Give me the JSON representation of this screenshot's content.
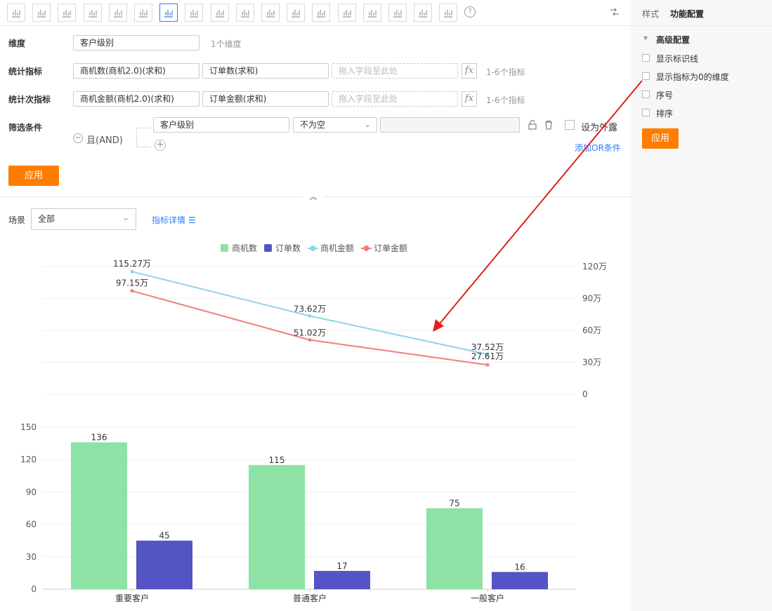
{
  "toolbar": {
    "icons": [
      "bar-chart",
      "line-chart",
      "pie-chart",
      "funnel",
      "funnel-alt",
      "table",
      "combo-chart",
      "text-card",
      "gauge",
      "china-map",
      "world-map",
      "globe-map",
      "bubble-map",
      "column-chart",
      "area-chart",
      "heat-table",
      "cross-table",
      "scatter-chart"
    ],
    "help": "?"
  },
  "config": {
    "dimension_label": "维度",
    "dimension_value": "客户级别",
    "dimension_hint": "1个维度",
    "metric_label": "统计指标",
    "metric_1": "商机数(商机2.0)(求和)",
    "metric_2": "订单数(求和)",
    "metric_drop": "拖入字段至此处",
    "metric_hint": "1-6个指标",
    "sub_metric_label": "统计次指标",
    "sub_metric_1": "商机金额(商机2.0)(求和)",
    "sub_metric_2": "订单金额(求和)",
    "sub_metric_drop": "拖入字段至此处",
    "sub_metric_hint": "1-6个指标",
    "fx": "fx",
    "filter_label": "筛选条件",
    "filter_logic": "且(AND)",
    "filter_field": "客户级别",
    "filter_op": "不为空",
    "filter_value": "",
    "expose_label": "设为外露",
    "add_or": "添加OR条件",
    "apply": "应用"
  },
  "scene": {
    "label": "场景",
    "value": "全部",
    "detail_link": "指标详情"
  },
  "side": {
    "tab_style": "样式",
    "tab_function": "功能配置",
    "section": "高级配置",
    "options": [
      "显示标识线",
      "显示指标为0的维度",
      "序号",
      "排序"
    ],
    "apply": "应用"
  },
  "colors": {
    "green": "#8de3a5",
    "purple": "#5454c4",
    "cyan": "#8dd5e8",
    "red": "#f27e7e",
    "accent": "#ff7d00",
    "link": "#2d7ff9",
    "arrow": "#e02020"
  },
  "chart_data": [
    {
      "type": "line",
      "categories": [
        "重要客户",
        "普通客户",
        "一般客户"
      ],
      "series": [
        {
          "name": "商机金额",
          "values": [
            115.27,
            73.62,
            37.52
          ],
          "labels": [
            "115.27万",
            "73.62万",
            "37.52万"
          ]
        },
        {
          "name": "订单金额",
          "values": [
            97.15,
            51.02,
            27.61
          ],
          "labels": [
            "97.15万",
            "51.02万",
            "27.61万"
          ]
        }
      ],
      "ylim": [
        0,
        120
      ],
      "yticks": [
        "0",
        "30万",
        "60万",
        "90万",
        "120万"
      ],
      "yaxis": "right",
      "grid": true
    },
    {
      "type": "bar",
      "categories": [
        "重要客户",
        "普通客户",
        "一般客户"
      ],
      "series": [
        {
          "name": "商机数",
          "values": [
            136,
            115,
            75
          ]
        },
        {
          "name": "订单数",
          "values": [
            45,
            17,
            16
          ]
        }
      ],
      "ylim": [
        0,
        150
      ],
      "yticks": [
        "0",
        "30",
        "60",
        "90",
        "120",
        "150"
      ],
      "grid": true
    }
  ],
  "legend": [
    "商机数",
    "订单数",
    "商机金额",
    "订单金额"
  ]
}
